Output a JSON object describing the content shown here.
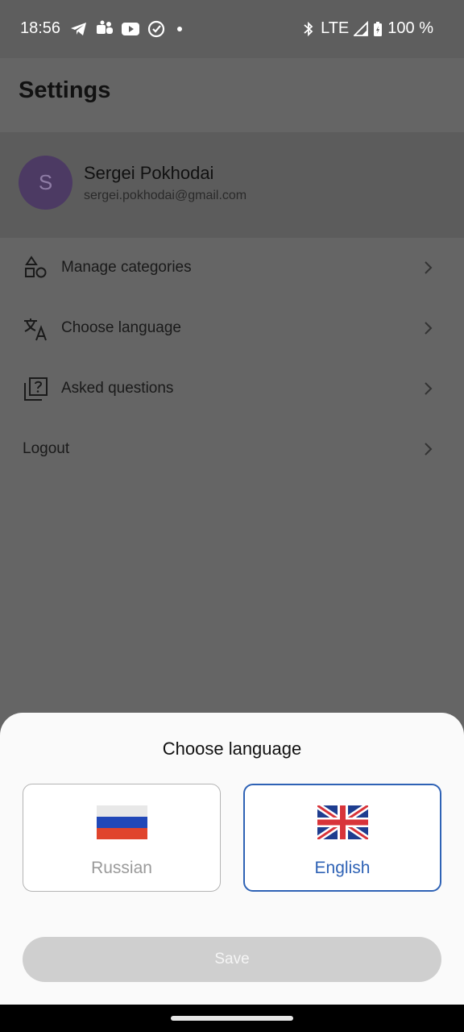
{
  "status_bar": {
    "time": "18:56",
    "left_icons": [
      "telegram-icon",
      "teams-icon",
      "youtube-icon",
      "check-circle-icon",
      "dot-icon"
    ],
    "network": "LTE",
    "battery": "100 %"
  },
  "page": {
    "title": "Settings"
  },
  "profile": {
    "initial": "S",
    "name": "Sergei Pokhodai",
    "email": "sergei.pokhodai@gmail.com",
    "avatar_color": "#4c3a63"
  },
  "menu": [
    {
      "label": "Manage categories",
      "icon": "shapes-icon"
    },
    {
      "label": "Choose language",
      "icon": "translate-icon"
    },
    {
      "label": "Asked questions",
      "icon": "question-box-icon"
    },
    {
      "label": "Logout",
      "icon": ""
    }
  ],
  "sheet": {
    "title": "Choose language",
    "options": [
      {
        "label": "Russian",
        "flag": "russia-flag",
        "selected": false
      },
      {
        "label": "English",
        "flag": "uk-flag",
        "selected": true
      }
    ],
    "save_label": "Save"
  },
  "colors": {
    "accent": "#2e62b5",
    "overlay": "#656565",
    "save_disabled": "#cfcfcf"
  }
}
